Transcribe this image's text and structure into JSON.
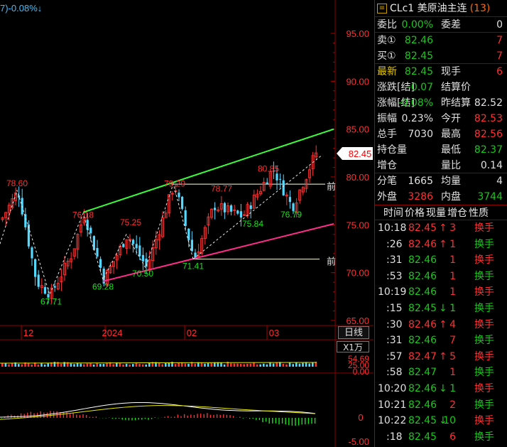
{
  "chart_header": "7)-0.08%↓",
  "axis_labels": [
    "95.00",
    "90.00",
    "85.00",
    "80.00",
    "75.00",
    "70.00",
    "65.00"
  ],
  "x_labels": [
    "12",
    "2024",
    "02",
    "03"
  ],
  "price_tag": "82.45",
  "front_labels": [
    "前",
    "前"
  ],
  "annotations": {
    "a1": "78.60",
    "a2": "67.71",
    "a3": "76.18",
    "a4": "69.28",
    "a5": "75.25",
    "a6": "70.50",
    "a7": "79.29",
    "a8": "71.41",
    "a9": "78.77",
    "a10": "80.85",
    "a11": "75.84",
    "a12": "76.79"
  },
  "tab_label": "日线",
  "volume_scale": "X1万",
  "volume_axis": [
    "54.69",
    "25.00",
    "0.00"
  ],
  "macd_axis": [
    "0",
    "-5.00"
  ],
  "quote": {
    "title": "CLc1 美原油主连",
    "count": "(13)",
    "rows": [
      {
        "l1": "委比",
        "v1": "0.00%",
        "l2": "委差",
        "v2": "0"
      },
      {
        "l1": "卖①",
        "v1": "82.46",
        "l2": "",
        "v2": "7"
      },
      {
        "l1": "买①",
        "v1": "82.45",
        "l2": "",
        "v2": "7"
      },
      {
        "l1": "最新",
        "v1": "82.45",
        "l2": "现手",
        "v2": "6"
      },
      {
        "l1": "涨跌[结]",
        "v1": "-0.07",
        "l2": "结算价",
        "v2": ""
      },
      {
        "l1": "涨幅[结]",
        "v1": "-0.08%",
        "l2": "昨结算",
        "v2": "82.52"
      },
      {
        "l1": "振幅",
        "v1": "0.23%",
        "l2": "今开",
        "v2": "82.53"
      },
      {
        "l1": "总手",
        "v1": "7030",
        "l2": "最高",
        "v2": "82.56"
      },
      {
        "l1": "持仓量",
        "v1": "",
        "l2": "最低",
        "v2": "82.37"
      },
      {
        "l1": "增仓",
        "v1": "",
        "l2": "量比",
        "v2": "0.14"
      },
      {
        "l1": "分笔",
        "v1": "1665",
        "l2": "均量",
        "v2": "4"
      },
      {
        "l1": "外盘",
        "v1": "3286",
        "l2": "内盘",
        "v2": "3744"
      }
    ]
  },
  "ticks_header": [
    "时间",
    "价格",
    "现量",
    "增仓",
    "性质"
  ],
  "ticks": [
    {
      "t": "10:18",
      "p": "82.45",
      "d": "↑",
      "v": "3",
      "n": "换手"
    },
    {
      "t": ":26",
      "p": "82.46",
      "d": "↑",
      "v": "1",
      "n": "换手"
    },
    {
      "t": ":31",
      "p": "82.46",
      "d": "",
      "v": "1",
      "n": "换手"
    },
    {
      "t": ":53",
      "p": "82.46",
      "d": "",
      "v": "1",
      "n": "换手"
    },
    {
      "t": "10:19",
      "p": "82.46",
      "d": "",
      "v": "1",
      "n": "换手"
    },
    {
      "t": ":15",
      "p": "82.45",
      "d": "↓",
      "v": "1",
      "n": "换手"
    },
    {
      "t": ":30",
      "p": "82.46",
      "d": "↑",
      "v": "4",
      "n": "换手"
    },
    {
      "t": ":31",
      "p": "82.46",
      "d": "",
      "v": "7",
      "n": "换手"
    },
    {
      "t": ":57",
      "p": "82.47",
      "d": "↑",
      "v": "5",
      "n": "换手"
    },
    {
      "t": ":58",
      "p": "82.47",
      "d": "",
      "v": "1",
      "n": "换手"
    },
    {
      "t": "10:20",
      "p": "82.46",
      "d": "↓",
      "v": "1",
      "n": "换手"
    },
    {
      "t": "10:21",
      "p": "82.46",
      "d": "",
      "v": "2",
      "n": "换手"
    },
    {
      "t": "10:22",
      "p": "82.45",
      "d": "↓",
      "v": "10",
      "n": "换手"
    },
    {
      "t": ":18",
      "p": "82.45",
      "d": "",
      "v": "6",
      "n": "换手"
    }
  ]
}
